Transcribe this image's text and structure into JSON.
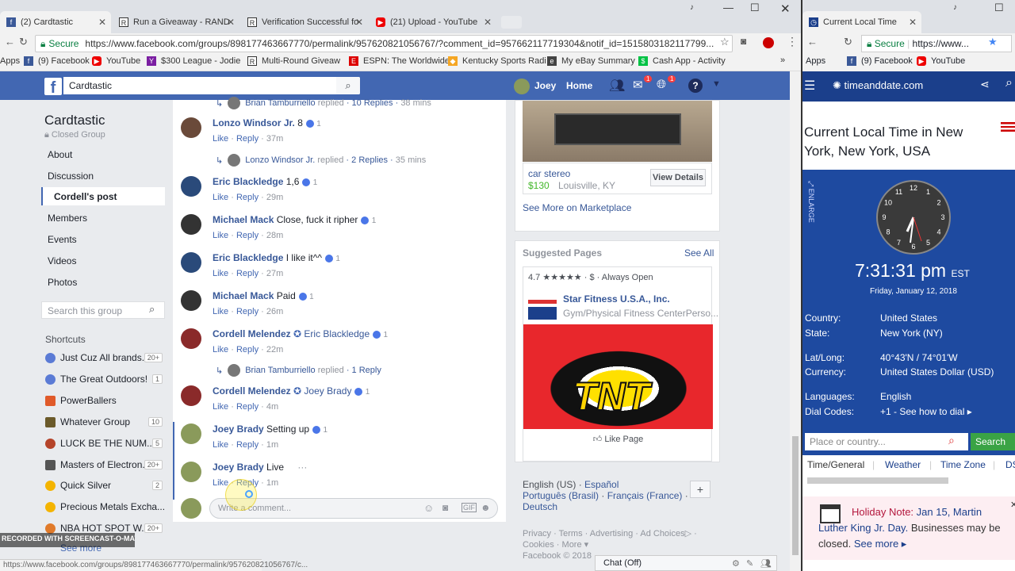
{
  "tabs": [
    {
      "title": "(2) Cardtastic",
      "icon": "facebook-icon"
    },
    {
      "title": "Run a Giveaway - RAND",
      "icon": "random-icon"
    },
    {
      "title": "Verification Successful fo",
      "icon": "random-icon"
    },
    {
      "title": "(21) Upload - YouTube",
      "icon": "youtube-icon"
    }
  ],
  "address": {
    "secure": "Secure",
    "url": "https://www.facebook.com/groups/898177463667770/permalink/957620821056767/?comment_id=957662117719304&notif_id=1515803182117799..."
  },
  "bookmarks": [
    "Apps",
    "(9) Facebook",
    "YouTube",
    "$300 League - Jodie",
    "Multi-Round Giveaw",
    "ESPN: The Worldwide",
    "Kentucky Sports Radi",
    "My eBay Summary",
    "Cash App - Activity"
  ],
  "fb": {
    "search_value": "Cardtastic",
    "user": "Joey",
    "home": "Home",
    "notif_count": "1",
    "group_name": "Cardtastic",
    "group_type": "Closed Group",
    "nav": [
      "About",
      "Discussion",
      "Cordell's post",
      "Members",
      "Events",
      "Videos",
      "Photos"
    ],
    "search_group_placeholder": "Search this group",
    "shortcuts_label": "Shortcuts",
    "shortcuts": [
      {
        "name": "Just Cuz All brands...",
        "count": "20+"
      },
      {
        "name": "The Great Outdoors!",
        "count": "1"
      },
      {
        "name": "PowerBallers",
        "count": ""
      },
      {
        "name": "Whatever Group",
        "count": "10"
      },
      {
        "name": "LUCK BE THE NUM...",
        "count": "5"
      },
      {
        "name": "Masters of Electron...",
        "count": "20+"
      },
      {
        "name": "Quick Silver",
        "count": "2"
      },
      {
        "name": "Precious Metals Excha...",
        "count": ""
      },
      {
        "name": "NBA HOT SPOT W...",
        "count": "20+"
      }
    ],
    "see_more": "See more",
    "comments": [
      {
        "name": "Lonzo Windsor Jr.",
        "text": "8",
        "like": "1",
        "time": "37m"
      },
      {
        "name": "Eric Blackledge",
        "text": "1,6",
        "like": "1",
        "time": "29m"
      },
      {
        "name": "Michael Mack",
        "text": "Close, fuck it ripher",
        "like": "1",
        "time": "28m"
      },
      {
        "name": "Eric Blackledge",
        "text": "I like it^^",
        "like": "1",
        "time": "27m"
      },
      {
        "name": "Michael Mack",
        "text": "Paid",
        "like": "1",
        "time": "26m"
      },
      {
        "name": "Cordell Melendez",
        "text": "Eric Blackledge",
        "like": "1",
        "time": "22m"
      },
      {
        "name": "Cordell Melendez",
        "text": "Joey Brady",
        "like": "1",
        "time": "4m"
      },
      {
        "name": "Joey Brady",
        "text": "Setting up",
        "like": "1",
        "time": "1m"
      },
      {
        "name": "Joey Brady",
        "text": "Live",
        "like": "",
        "time": "1m"
      }
    ],
    "like_label": "Like",
    "reply_label": "Reply",
    "replies": [
      {
        "name": "Brian Tamburriello",
        "verb": "replied",
        "count": "10 Replies",
        "time": "38 mins"
      },
      {
        "name": "Lonzo Windsor Jr.",
        "verb": "replied",
        "count": "2 Replies",
        "time": "35 mins"
      },
      {
        "name": "Brian Tamburriello",
        "verb": "replied",
        "count": "1 Reply",
        "time": ""
      }
    ],
    "write_comment": "Write a comment...",
    "marketplace": {
      "item": "car stereo",
      "price": "$130",
      "location": "Louisville, KY",
      "view": "View Details",
      "see_more": "See More on Marketplace"
    },
    "suggested": {
      "title": "Suggested Pages",
      "see_all": "See All",
      "rating": "4.7",
      "stars": "★★★★★",
      "price": "$",
      "open": "Always Open",
      "page_name": "Star Fitness U.S.A., Inc.",
      "page_cat": "Gym/Physical Fitness CenterPerso...",
      "tnt": "TNT",
      "like_page": "Like Page"
    },
    "languages": [
      "English (US)",
      "Español",
      "Português (Brasil)",
      "Français (France)",
      "Deutsch"
    ],
    "footer": [
      "Privacy",
      "Terms",
      "Advertising",
      "Ad Choices",
      "Cookies",
      "More",
      "Facebook © 2018"
    ],
    "chat": "Chat (Off)"
  },
  "status_url": "https://www.facebook.com/groups/898177463667770/permalink/957620821056767/c...",
  "watermark": "RECORDED WITH SCREENCAST-O-MATIC",
  "right": {
    "tab": "Current Local Time",
    "secure": "Secure",
    "url": "https://www...",
    "bookmarks": [
      "Apps",
      "(9) Facebook",
      "YouTube"
    ],
    "site": "timeanddate.com",
    "heading": "Current Local Time in New York, New York, USA",
    "enlarge": "ENLARGE",
    "time": "7:31:31 pm",
    "tz": "EST",
    "date": "Friday, January 12, 2018",
    "clock_nums": [
      "12",
      "1",
      "2",
      "3",
      "4",
      "5",
      "6",
      "7",
      "8",
      "9",
      "10",
      "11"
    ],
    "info": [
      {
        "k": "Country:",
        "v": "United States"
      },
      {
        "k": "State:",
        "v": "New York (NY)"
      },
      {
        "k": "Lat/Long:",
        "v": "40°43'N / 74°01'W"
      },
      {
        "k": "Currency:",
        "v": "United States Dollar (USD)"
      },
      {
        "k": "Languages:",
        "v": "English"
      },
      {
        "k": "Dial Codes:",
        "v": "+1 - See how to dial ▸"
      }
    ],
    "place_placeholder": "Place or country...",
    "search": "Search",
    "subtabs": [
      "Time/General",
      "Weather",
      "Time Zone",
      "DS"
    ],
    "holiday": {
      "label": "Holiday Note:",
      "link": "Jan 15, Martin Luther King Jr. Day.",
      "text": "Businesses may be closed.",
      "see_more": "See more ▸"
    }
  }
}
